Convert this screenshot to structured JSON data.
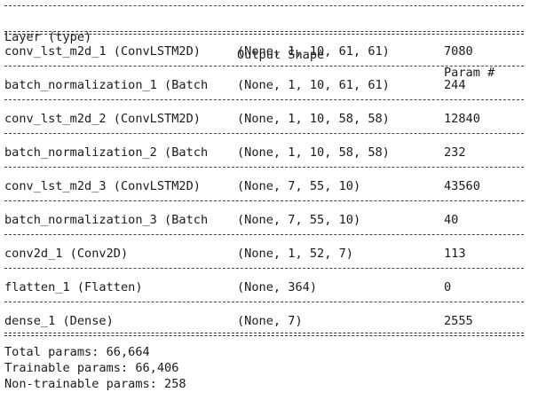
{
  "headers": {
    "layer": "Layer (type)",
    "output_shape": "Output Shape",
    "param": "Param #"
  },
  "rows": [
    {
      "layer": "conv_lst_m2d_1 (ConvLSTM2D)",
      "shape": "(None, 1, 10, 61, 61)",
      "params": "7080"
    },
    {
      "layer": "batch_normalization_1 (Batch",
      "shape": "(None, 1, 10, 61, 61)",
      "params": "244"
    },
    {
      "layer": "conv_lst_m2d_2 (ConvLSTM2D)",
      "shape": "(None, 1, 10, 58, 58)",
      "params": "12840"
    },
    {
      "layer": "batch_normalization_2 (Batch",
      "shape": "(None, 1, 10, 58, 58)",
      "params": "232"
    },
    {
      "layer": "conv_lst_m2d_3 (ConvLSTM2D)",
      "shape": "(None, 7, 55, 10)",
      "params": "43560"
    },
    {
      "layer": "batch_normalization_3 (Batch",
      "shape": "(None, 7, 55, 10)",
      "params": "40"
    },
    {
      "layer": "conv2d_1 (Conv2D)",
      "shape": "(None, 1, 52, 7)",
      "params": "113"
    },
    {
      "layer": "flatten_1 (Flatten)",
      "shape": "(None, 364)",
      "params": "0"
    },
    {
      "layer": "dense_1 (Dense)",
      "shape": "(None, 7)",
      "params": "2555"
    }
  ],
  "totals": {
    "total": "Total params: 66,664",
    "trainable": "Trainable params: 66,406",
    "non_trainable": "Non-trainable params: 258"
  }
}
